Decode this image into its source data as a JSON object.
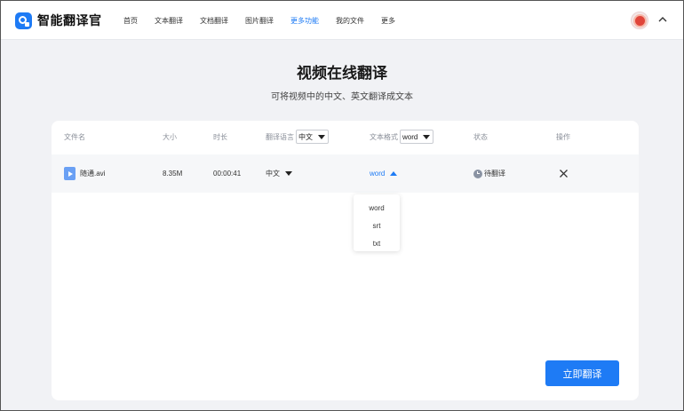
{
  "app": {
    "name": "智能翻译官"
  },
  "nav": {
    "items": [
      {
        "label": "首页"
      },
      {
        "label": "文本翻译"
      },
      {
        "label": "文档翻译"
      },
      {
        "label": "图片翻译"
      },
      {
        "label": "更多功能",
        "active": true
      },
      {
        "label": "我的文件"
      },
      {
        "label": "更多"
      }
    ]
  },
  "hero": {
    "title": "视频在线翻译",
    "subtitle": "可将视频中的中文、英文翻译成文本"
  },
  "table": {
    "headers": {
      "filename": "文件名",
      "size": "大小",
      "duration": "时长",
      "language": "翻译语言",
      "format": "文本格式",
      "status": "状态",
      "action": "操作"
    },
    "header_language_select": "中文",
    "header_format_select": "word",
    "row": {
      "filename": "随通.avi",
      "size": "8.35M",
      "duration": "00:00:41",
      "language": "中文",
      "format": "word",
      "status": "待翻译"
    }
  },
  "format_dropdown": {
    "options": [
      "word",
      "srt",
      "txt"
    ]
  },
  "actions": {
    "translate": "立即翻译"
  },
  "colors": {
    "accent": "#1e7bf5",
    "background": "#f1f2f5"
  },
  "icons": [
    "app-logo-icon",
    "avatar",
    "chevron-up-icon",
    "video-file-icon",
    "caret-down-icon",
    "caret-up-icon",
    "clock-icon",
    "close-icon"
  ]
}
